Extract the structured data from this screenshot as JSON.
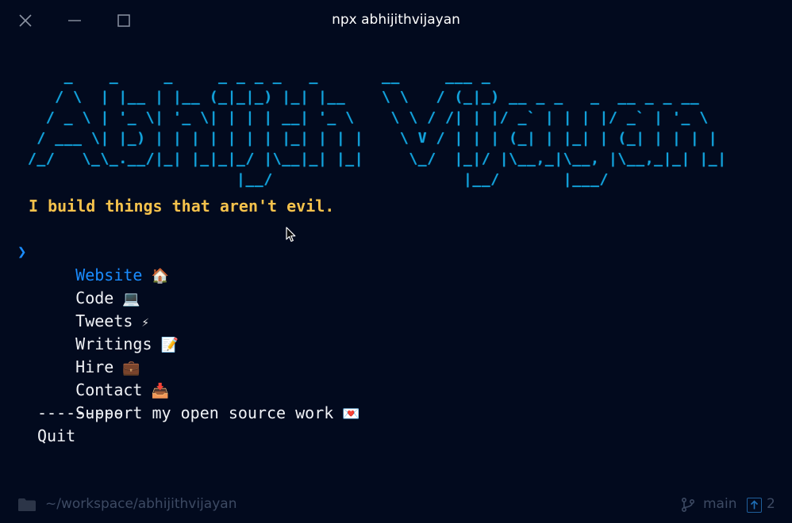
{
  "window": {
    "title": "npx abhijithvijayan"
  },
  "banner": {
    "ascii_art": "    _    _     _     _ _ _ _   _       __     ___ _\n   / \\  | |__ | |__ (_|_|_) |_| |__    \\ \\   / (_|_) __ _ _   _  __ _ _ __\n  / _ \\ | '_ \\| '_ \\| | | | __| '_ \\    \\ \\ / /| | |/ _` | | | |/ _` | '_ \\\n / ___ \\| |_) | | | | | | | |_| | | |    \\ V / | | | (_| | |_| | (_| | | | |\n/_/   \\_\\_.__/|_| |_|_|_/ |\\__|_| |_|     \\_/  |_|/ |\\__,_|\\__, |\\__,_|_| |_|\n                       |__/                     |__/       |___/"
  },
  "tagline": "I build things that aren't evil.",
  "menu": {
    "pointer": "❯",
    "items": [
      {
        "label": "Website",
        "icon": "house-icon",
        "glyph": "🏠",
        "selected": true
      },
      {
        "label": "Code",
        "icon": "computer-icon",
        "glyph": "💻",
        "selected": false
      },
      {
        "label": "Tweets",
        "icon": "lightning-icon",
        "glyph": "⚡",
        "selected": false
      },
      {
        "label": "Writings",
        "icon": "memo-icon",
        "glyph": "📝",
        "selected": false
      },
      {
        "label": "Hire",
        "icon": "briefcase-icon",
        "glyph": "💼",
        "selected": false
      },
      {
        "label": "Contact",
        "icon": "inbox-icon",
        "glyph": "📥",
        "selected": false
      },
      {
        "label": "Support my open source work",
        "icon": "love-letter-icon",
        "glyph": "💌",
        "selected": false
      }
    ],
    "separator": "---------",
    "quit_label": "Quit"
  },
  "statusbar": {
    "cwd": "~/workspace/abhijithvijayan",
    "branch": "main",
    "ahead_count": "2"
  },
  "colors": {
    "background": "#020a1e",
    "banner": "#13a3dc",
    "tagline": "#f5c24c",
    "selected": "#1a8cff",
    "text": "#f1f3f7",
    "statusbar": "#3d4a63"
  }
}
